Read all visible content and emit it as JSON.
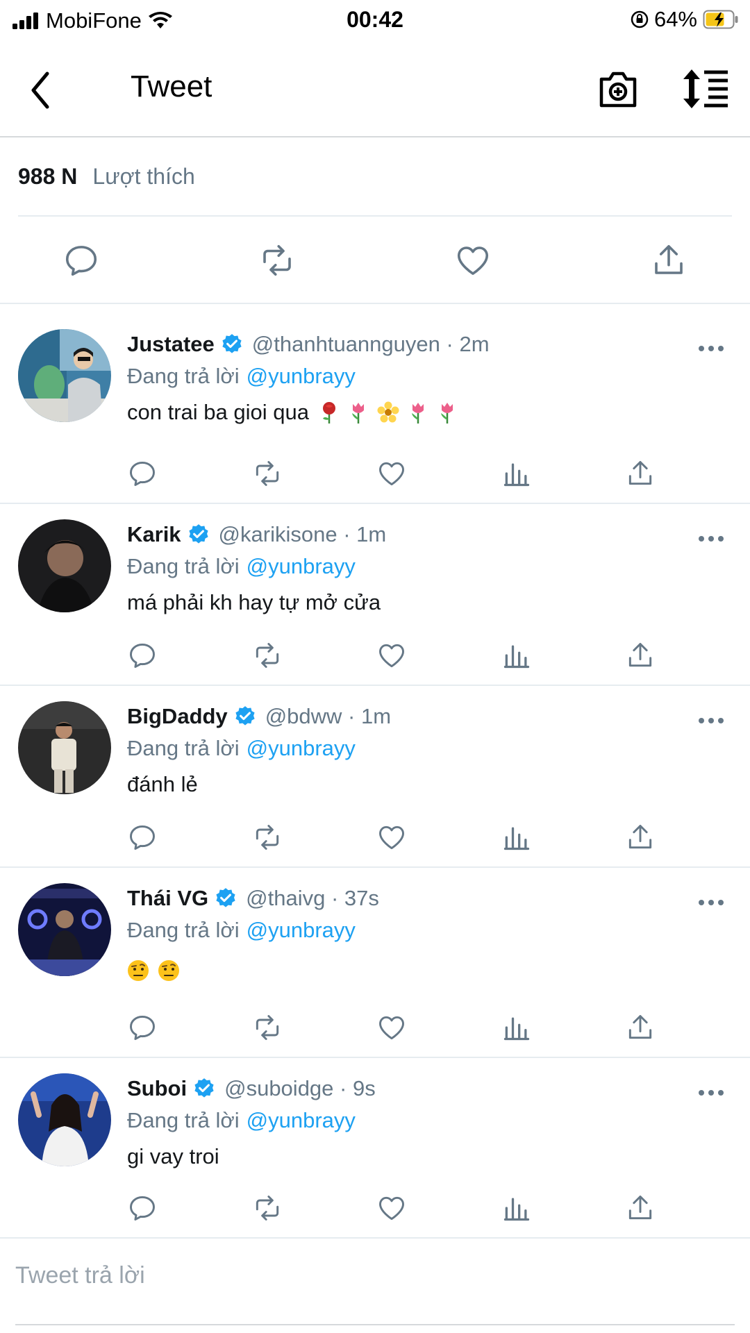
{
  "status_bar": {
    "carrier": "MobiFone",
    "time": "00:42",
    "battery": "64%"
  },
  "nav": {
    "title": "Tweet"
  },
  "likes": {
    "count": "988 N",
    "label": "Lượt thích"
  },
  "replies": [
    {
      "name": "Justatee",
      "handle": "@thanhtuannguyen",
      "time": "2m",
      "replying_prefix": "Đang trả lời",
      "mention": "@yunbrayy",
      "text": "con trai ba gioi qua",
      "emojis": [
        "rose-emoji",
        "tulip-emoji",
        "blossom-emoji",
        "tulip-emoji",
        "tulip-emoji"
      ]
    },
    {
      "name": "Karik",
      "handle": "@karikisone",
      "time": "1m",
      "replying_prefix": "Đang trả lời",
      "mention": "@yunbrayy",
      "text": "má phải kh hay tự mở cửa",
      "emojis": []
    },
    {
      "name": "BigDaddy",
      "handle": "@bdww",
      "time": "1m",
      "replying_prefix": "Đang trả lời",
      "mention": "@yunbrayy",
      "text": "đánh lẻ",
      "emojis": []
    },
    {
      "name": "Thái VG",
      "handle": "@thaivg",
      "time": "37s",
      "replying_prefix": "Đang trả lời",
      "mention": "@yunbrayy",
      "text": "",
      "emojis": [
        "raised-eyebrow-emoji",
        "raised-eyebrow-emoji"
      ]
    },
    {
      "name": "Suboi",
      "handle": "@suboidge",
      "time": "9s",
      "replying_prefix": "Đang trả lời",
      "mention": "@yunbrayy",
      "text": "gi vay troi",
      "emojis": []
    }
  ],
  "compose": {
    "placeholder": "Tweet trả lời"
  },
  "colors": {
    "accent": "#1da1f2",
    "secondary_text": "#657786",
    "icon": "#657786",
    "divider": "#e6ecf0"
  }
}
